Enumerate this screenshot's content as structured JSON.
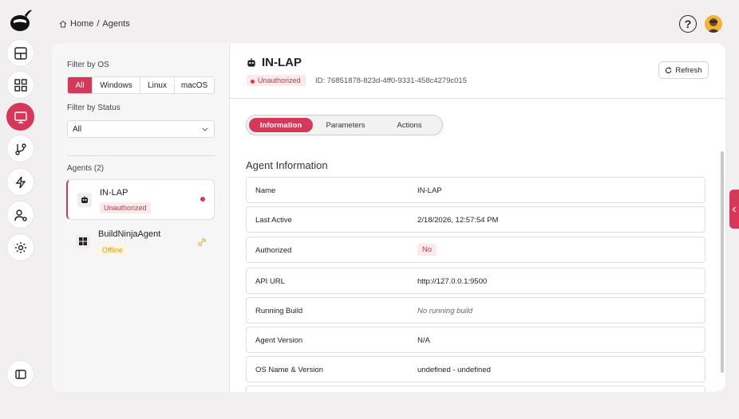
{
  "breadcrumb": {
    "home": "Home",
    "separator": "/",
    "current": "Agents"
  },
  "header": {
    "help_label": "?"
  },
  "rail": {
    "items": [
      "dashboard-icon",
      "grid-icon",
      "monitor-icon",
      "git-branch-icon",
      "lightning-icon",
      "user-settings-icon",
      "gear-icon"
    ],
    "active": "monitor-icon",
    "bottom": "panel-toggle-icon"
  },
  "filters": {
    "os_label": "Filter by OS",
    "os_options": [
      "All",
      "Windows",
      "Linux",
      "macOS"
    ],
    "os_selected": "All",
    "status_label": "Filter by Status",
    "status_value": "All"
  },
  "agents": {
    "count_label": "Agents (2)",
    "items": [
      {
        "name": "IN-LAP",
        "status": "Unauthorized",
        "icon": "robot-icon"
      },
      {
        "name": "BuildNinjaAgent",
        "status": "Offline",
        "icon": "windows-icon"
      }
    ]
  },
  "detail": {
    "title": "IN-LAP",
    "status": "Unauthorized",
    "id_text": "ID: 76851878-823d-4ff0-9331-458c4279c015",
    "refresh_label": "Refresh",
    "tabs": [
      "Information",
      "Parameters",
      "Actions"
    ],
    "active_tab": "Information",
    "section_title": "Agent Information",
    "rows": [
      {
        "key": "Name",
        "value": "IN-LAP"
      },
      {
        "key": "Last Active",
        "value": "2/18/2026, 12:57:54 PM"
      },
      {
        "key": "Authorized",
        "value": "No"
      },
      {
        "key": "API URL",
        "value": "http://127.0.0.1:9500"
      },
      {
        "key": "Running Build",
        "value": "No running build"
      },
      {
        "key": "Agent Version",
        "value": "N/A"
      },
      {
        "key": "OS Name & Version",
        "value": "undefined - undefined"
      }
    ]
  },
  "colors": {
    "accent": "#d6385a",
    "unauth_bg": "#fde8ea",
    "offline_text": "#d69a17"
  }
}
